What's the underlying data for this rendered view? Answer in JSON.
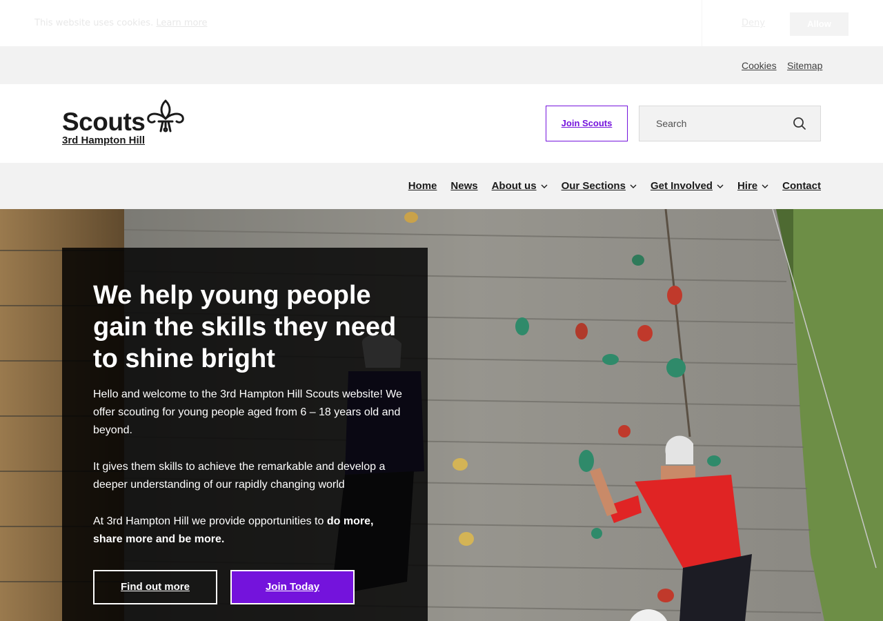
{
  "cookie": {
    "message": "This website uses cookies.",
    "learn_more": "Learn more",
    "deny": "Deny",
    "allow": "Allow"
  },
  "utility": {
    "cookies": "Cookies",
    "sitemap": "Sitemap"
  },
  "header": {
    "logo_text": "Scouts",
    "group_name": "3rd Hampton Hill",
    "join_button": "Join Scouts",
    "search_placeholder": "Search"
  },
  "nav": {
    "items": [
      {
        "label": "Home",
        "dropdown": false
      },
      {
        "label": "News",
        "dropdown": false
      },
      {
        "label": "About us",
        "dropdown": true
      },
      {
        "label": "Our Sections",
        "dropdown": true
      },
      {
        "label": "Get Involved",
        "dropdown": true
      },
      {
        "label": "Hire",
        "dropdown": true
      },
      {
        "label": "Contact",
        "dropdown": false
      }
    ]
  },
  "hero": {
    "title": "We help young people gain the skills they need to shine bright",
    "para1": "Hello and welcome to the 3rd Hampton Hill Scouts website! We offer scouting for young people aged from 6 – 18 years old and beyond.",
    "para2": "It gives them skills to achieve the remarkable and develop a deeper understanding of our rapidly changing world",
    "para3_prefix": "At 3rd Hampton Hill we provide opportunities to ",
    "para3_bold": "do more, share more and be more.",
    "btn_find": "Find out more",
    "btn_join": "Join Today"
  },
  "colors": {
    "brand_purple": "#7413dc",
    "nav_bg": "#f2f2f2",
    "panel_bg": "rgba(0,0,0,0.82)"
  },
  "icons": {
    "logo": "fleur-de-lis-icon",
    "search": "search-icon",
    "dropdown": "chevron-down-icon"
  }
}
